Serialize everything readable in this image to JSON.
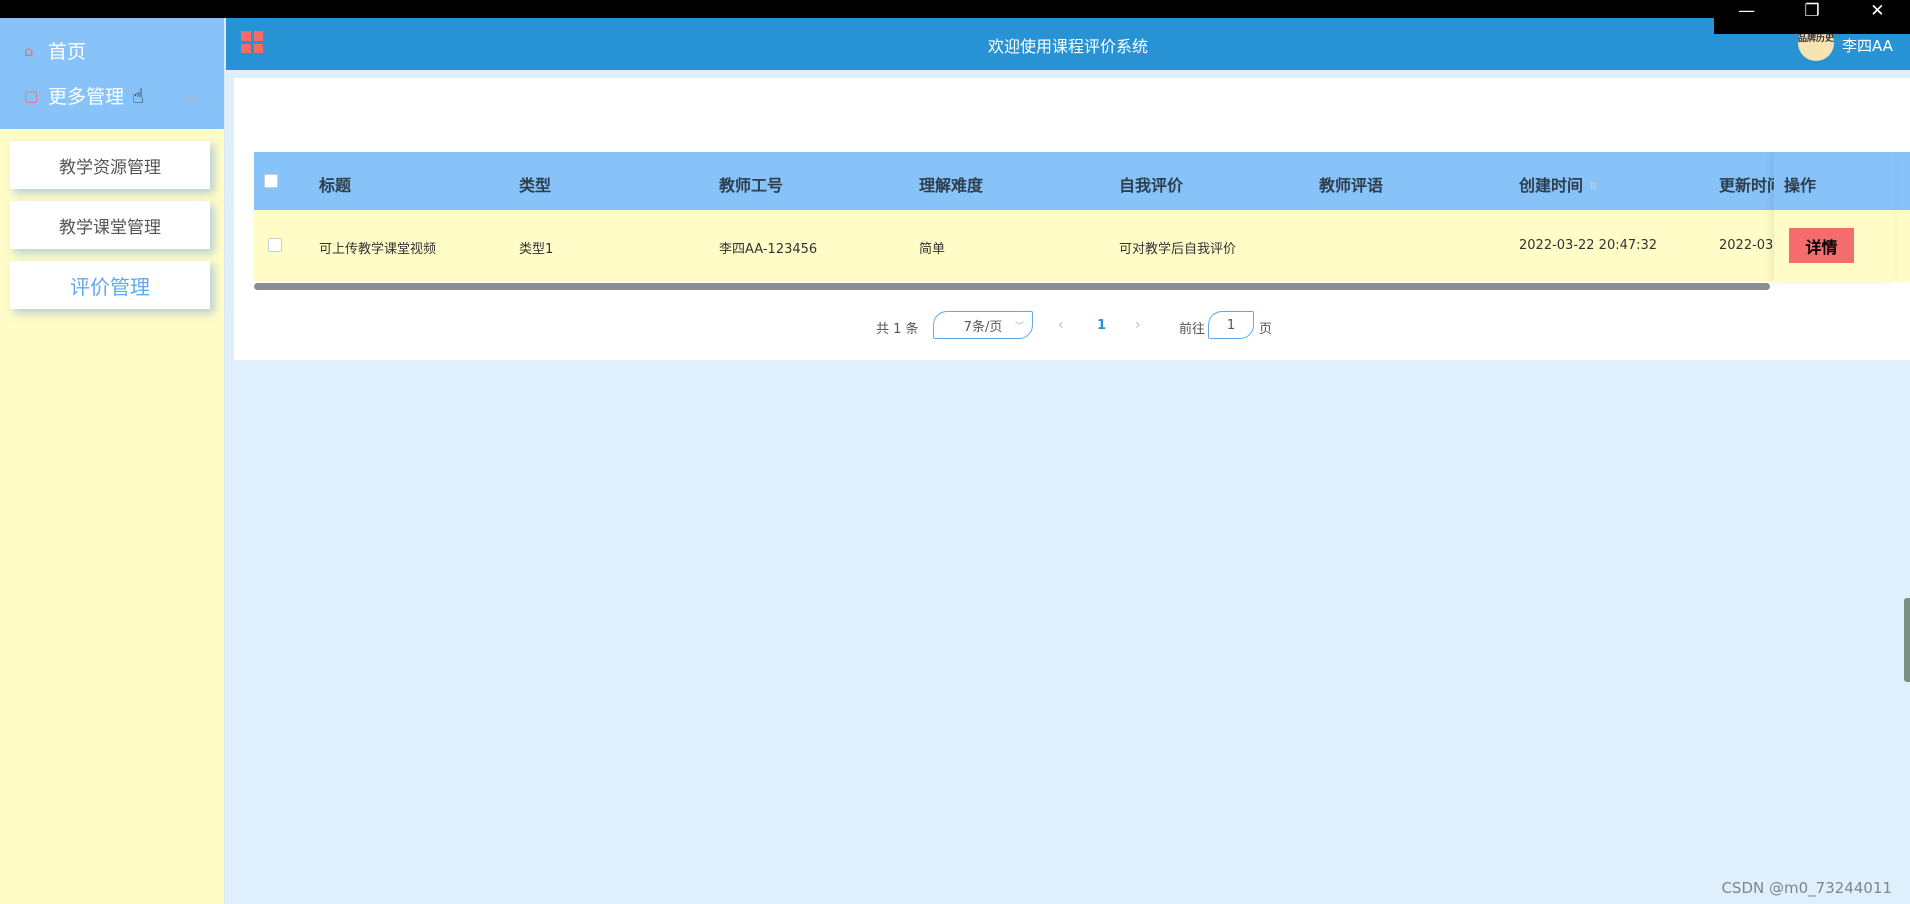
{
  "window_controls": {
    "minimize": "—",
    "restore": "❐",
    "close": "✕"
  },
  "sidebar": {
    "home_label": "首页",
    "more_label": "更多管理",
    "sub_items": [
      {
        "label": "教学资源管理"
      },
      {
        "label": "教学课堂管理"
      },
      {
        "label": "评价管理"
      }
    ]
  },
  "header": {
    "title": "欢迎使用课程评价系统",
    "avatar_text": "品牌历史",
    "user_name": "李四AA"
  },
  "table": {
    "columns": [
      "标题",
      "类型",
      "教师工号",
      "理解难度",
      "自我评价",
      "教师评语",
      "创建时间",
      "更新时间"
    ],
    "operation_header": "操作",
    "rows": [
      {
        "title": "可上传教学课堂视频",
        "type": "类型1",
        "teacher_id": "李四AA-123456",
        "difficulty": "简单",
        "self_eval": "可对教学后自我评价",
        "teacher_comment": "",
        "created": "2022-03-22 20:47:32",
        "updated": "2022-03-"
      }
    ],
    "detail_label": "详情"
  },
  "pagination": {
    "total": "共 1 条",
    "page_size": "7条/页",
    "current_page": "1",
    "goto_label": "前往",
    "goto_value": "1",
    "page_suffix": "页"
  },
  "watermark": "CSDN @m0_73244011",
  "colors": {
    "header_bg": "#2893d4",
    "sidebar_top": "#87c3f9",
    "sidebar_bg": "#fffcc7",
    "table_header": "#87c3f9",
    "row_bg": "#fffcc7",
    "detail_button": "#f56c6c",
    "page_bg": "#e0effc"
  }
}
